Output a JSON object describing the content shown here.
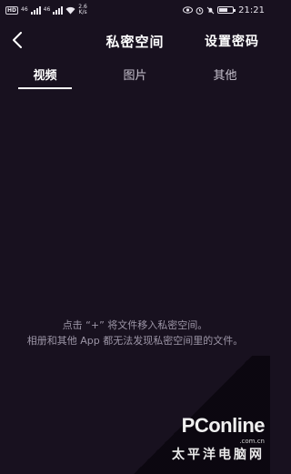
{
  "status_bar": {
    "left_badges": [
      "HD",
      "46",
      "4G",
      "46"
    ],
    "speed": "2.6",
    "speed_unit": "K/s",
    "time": "21:21",
    "battery_percent": 60
  },
  "header": {
    "title": "私密空间",
    "settings_label": "设置密码"
  },
  "tabs": [
    {
      "label": "视频",
      "active": true
    },
    {
      "label": "图片",
      "active": false
    },
    {
      "label": "其他",
      "active": false
    }
  ],
  "empty_state": {
    "line1": "点击 “+” 将文件移入私密空间。",
    "line2": "相册和其他 App 都无法发现私密空间里的文件。"
  },
  "watermark": {
    "brand": "PConline",
    "domain": ".com.cn",
    "cn": "太平洋电脑网"
  }
}
